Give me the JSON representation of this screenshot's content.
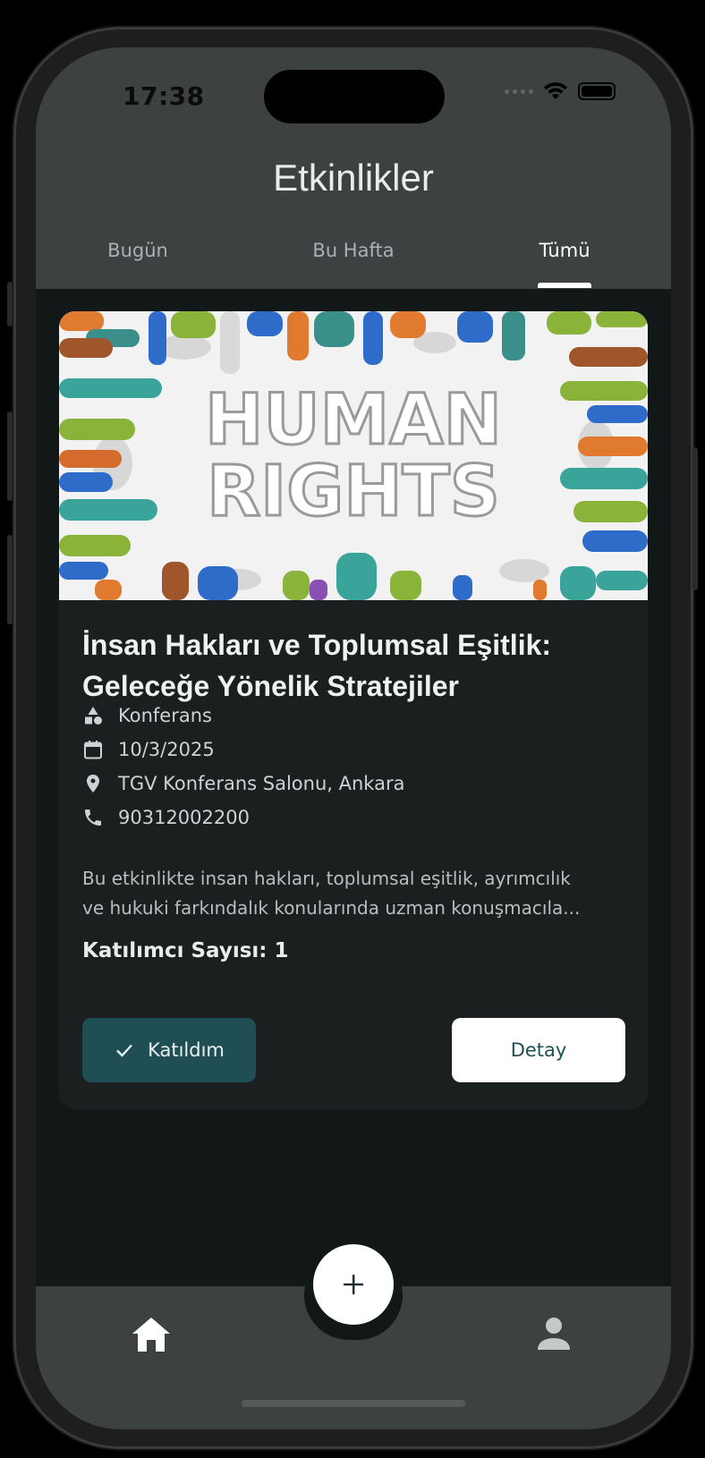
{
  "status_bar": {
    "time": "17:38"
  },
  "header": {
    "title": "Etkinlikler",
    "tabs": [
      {
        "label": "Bugün",
        "active": false
      },
      {
        "label": "Bu Hafta",
        "active": false
      },
      {
        "label": "Tümü",
        "active": true
      }
    ]
  },
  "event": {
    "image_text_line1": "HUMAN",
    "image_text_line2": "RIGHTS",
    "title_line1": "İnsan Hakları ve Toplumsal Eşitlik:",
    "title_line2": "Geleceğe Yönelik Stratejiler",
    "category": "Konferans",
    "date": "10/3/2025",
    "location": "TGV Konferans Salonu, Ankara",
    "phone": "90312002200",
    "description_line1": "Bu etkinlikte insan hakları, toplumsal eşitlik, ayrımcılık",
    "description_line2": "ve hukuki farkındalık konularında uzman konuşmacıla...",
    "participant_count": "Katılımcı Sayısı: 1",
    "join_label": "Katıldım",
    "detail_label": "Detay"
  },
  "colors": {
    "header_bg": "#3d4142",
    "screen_bg": "#121717",
    "card_bg": "#1b1f20",
    "accent_teal": "#1f4f55"
  },
  "icons": {
    "category": "category-icon",
    "date": "calendar-icon",
    "location": "location-pin-icon",
    "phone": "phone-icon",
    "join": "check-icon",
    "fab": "plus-icon",
    "nav_home": "home-icon",
    "nav_profile": "person-icon"
  }
}
